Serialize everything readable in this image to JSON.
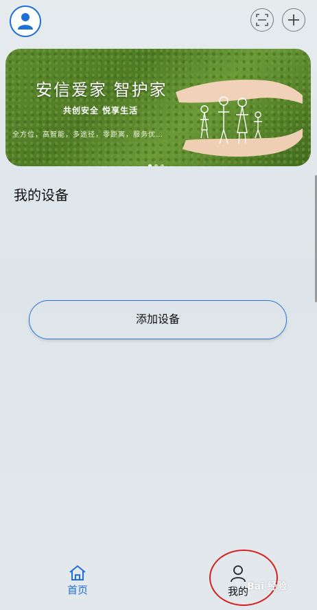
{
  "header": {
    "avatar_icon": "user-avatar-icon",
    "scan_icon": "scan-icon",
    "add_icon": "plus-icon",
    "accent": "#1f6fd6"
  },
  "banner": {
    "title": "安信爱家 智护家",
    "subtitle": "共创安全 悦享生活",
    "tagline": "全方位，高智能，多途径，零距离，服务优…",
    "page_indicator": {
      "count": 3,
      "active": 1
    }
  },
  "devices": {
    "section_title": "我的设备",
    "add_button_label": "添加设备"
  },
  "tabbar": {
    "tabs": [
      {
        "label": "首页",
        "icon": "home-icon",
        "active": true
      },
      {
        "label": "我的",
        "icon": "person-icon",
        "active": false
      }
    ]
  },
  "watermark": {
    "text": "Bai 经验"
  },
  "annotation": {
    "color": "#d52020"
  }
}
